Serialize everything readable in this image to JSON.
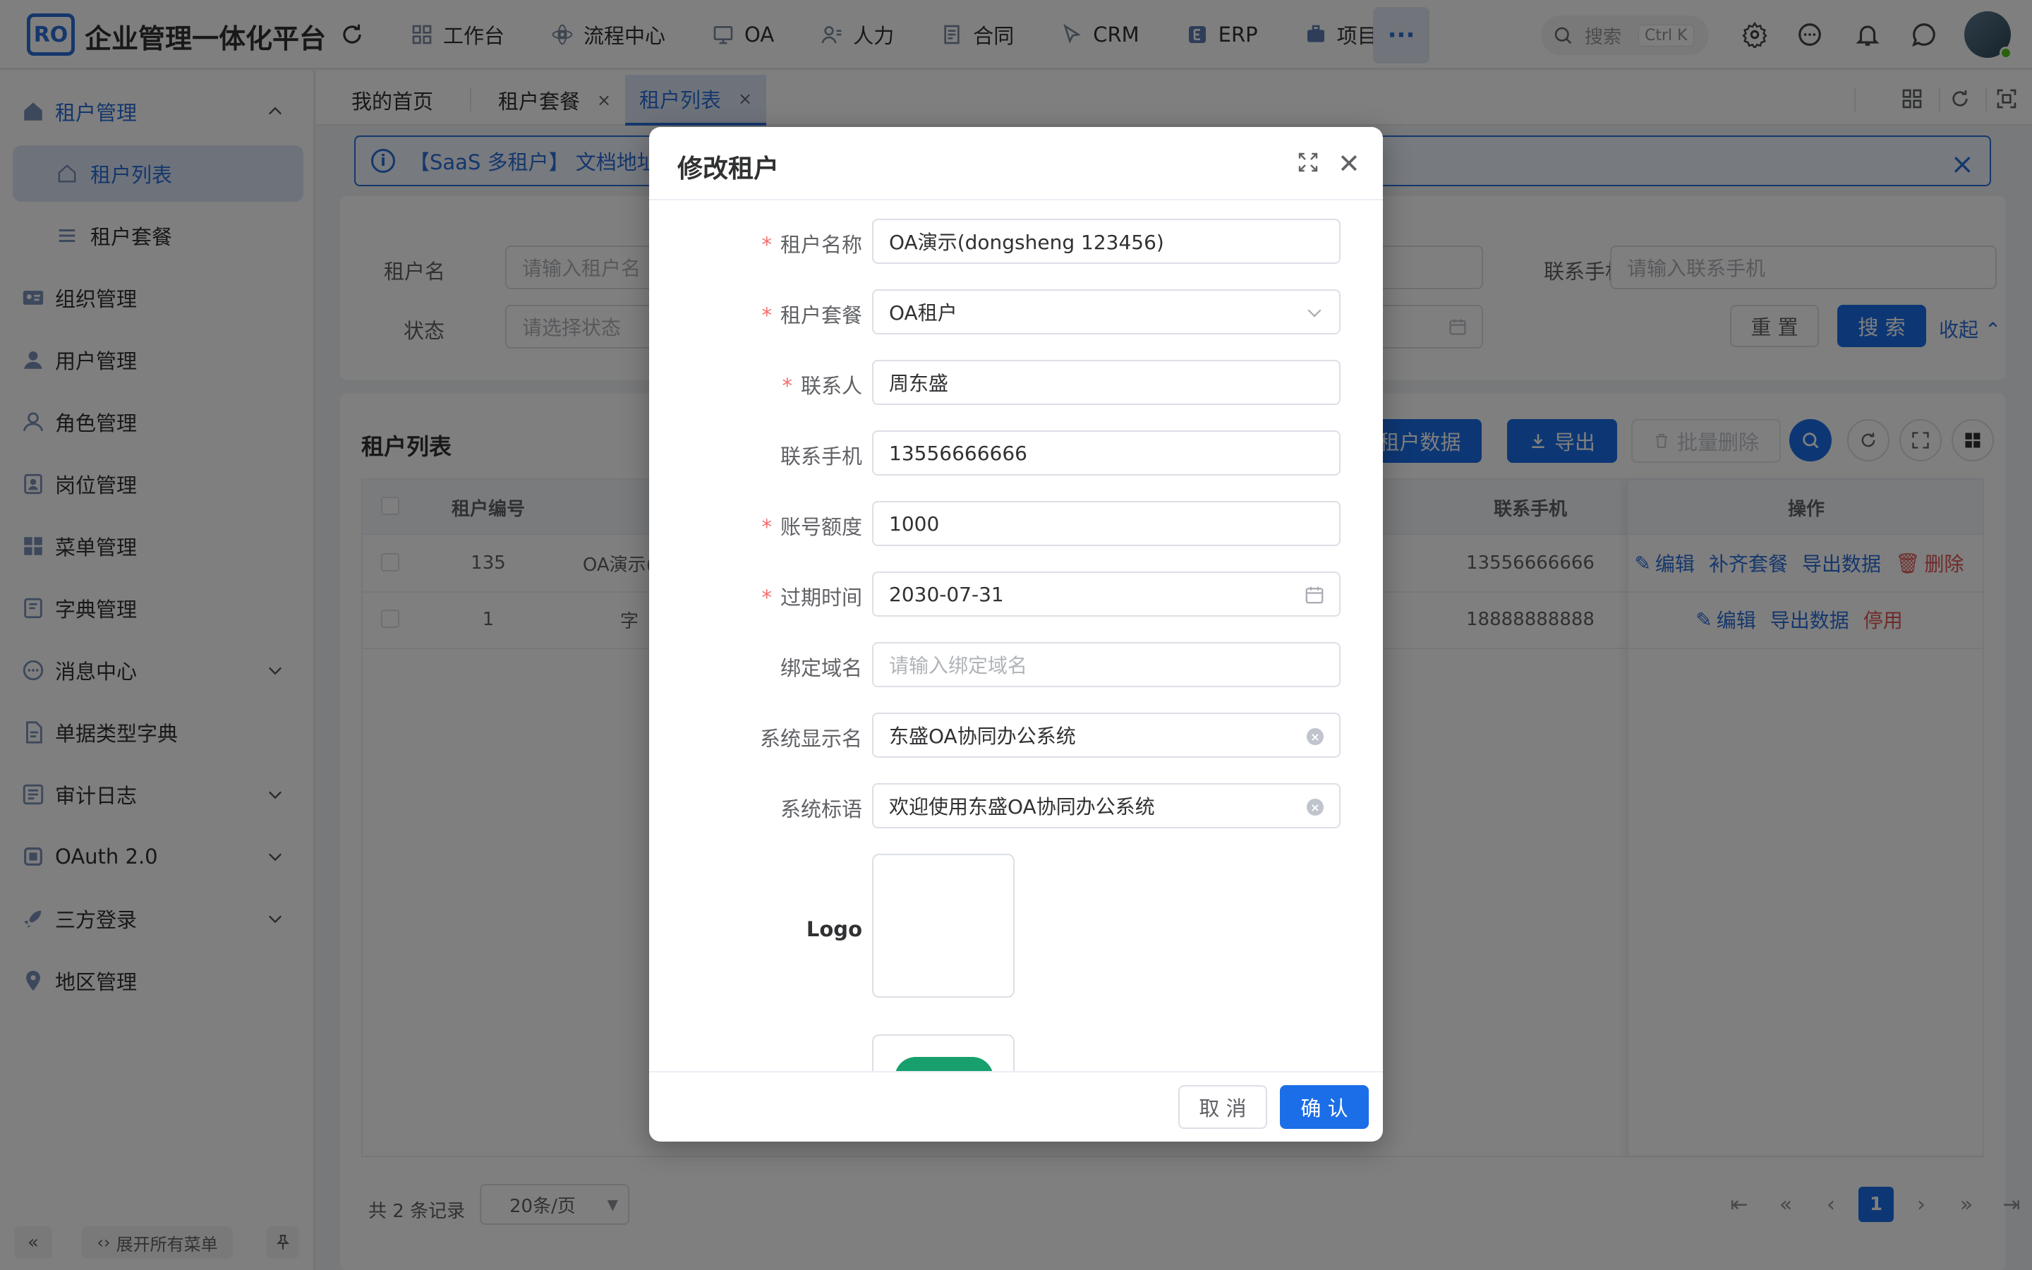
{
  "app": {
    "logo_text": "RO",
    "title": "企业管理一体化平台"
  },
  "topnav": [
    {
      "label": "工作台",
      "icon": "dashboard-icon"
    },
    {
      "label": "流程中心",
      "icon": "workflow-icon"
    },
    {
      "label": "OA",
      "icon": "oa-icon"
    },
    {
      "label": "人力",
      "icon": "hr-icon"
    },
    {
      "label": "合同",
      "icon": "contract-icon"
    },
    {
      "label": "CRM",
      "icon": "crm-icon"
    },
    {
      "label": "ERP",
      "icon": "erp-icon"
    },
    {
      "label": "项目",
      "icon": "project-icon"
    }
  ],
  "more_label": "···",
  "search": {
    "placeholder": "搜索",
    "shortcut": "Ctrl K"
  },
  "sidebar": {
    "group": "租户管理",
    "subitems": [
      {
        "label": "租户列表"
      },
      {
        "label": "租户套餐"
      }
    ],
    "items": [
      {
        "label": "组织管理"
      },
      {
        "label": "用户管理"
      },
      {
        "label": "角色管理"
      },
      {
        "label": "岗位管理"
      },
      {
        "label": "菜单管理"
      },
      {
        "label": "字典管理"
      },
      {
        "label": "消息中心"
      },
      {
        "label": "单据类型字典"
      },
      {
        "label": "审计日志"
      },
      {
        "label": "OAuth 2.0"
      },
      {
        "label": "三方登录"
      },
      {
        "label": "地区管理"
      }
    ],
    "footer": {
      "collapse": "«",
      "expand_all": "展开所有菜单"
    }
  },
  "tabs": [
    {
      "label": "我的首页"
    },
    {
      "label": "租户套餐",
      "close": "×"
    },
    {
      "label": "租户列表",
      "close": "×"
    }
  ],
  "alert": {
    "text": "【SaaS 多租户】 文档地址:",
    "close": "×"
  },
  "filter": {
    "tenant_name_label": "租户名",
    "tenant_name_placeholder": "请输入租户名",
    "phone_label": "联系手机",
    "phone_placeholder": "请输入联系手机",
    "status_label": "状态",
    "status_placeholder": "请选择状态",
    "reset": "重 置",
    "search": "搜 索",
    "collapse": "收起"
  },
  "table": {
    "title": "租户列表",
    "import_label": "入租户数据",
    "export_label": "导出",
    "batch_delete": "批量删除",
    "columns": [
      "租户编号",
      "联系手机",
      "操作"
    ],
    "rows": [
      {
        "id": "135",
        "name": "OA演示(do",
        "phone": "13556666666",
        "ops": [
          {
            "label": "编辑"
          },
          {
            "label": "补齐套餐"
          },
          {
            "label": "导出数据"
          },
          {
            "label": "删除",
            "danger": true
          }
        ]
      },
      {
        "id": "1",
        "name": "字",
        "phone": "18888888888",
        "ops": [
          {
            "label": "编辑"
          },
          {
            "label": "导出数据"
          },
          {
            "label": "停用",
            "danger": true
          }
        ]
      }
    ]
  },
  "pager": {
    "total": "共 2 条记录",
    "size": "20条/页",
    "current": "1"
  },
  "dialog": {
    "title": "修改租户",
    "fields": {
      "tenant_name": {
        "label": "租户名称",
        "value": "OA演示(dongsheng 123456)"
      },
      "package": {
        "label": "租户套餐",
        "value": "OA租户"
      },
      "contact": {
        "label": "联系人",
        "value": "周东盛"
      },
      "phone": {
        "label": "联系手机",
        "value": "13556666666"
      },
      "quota": {
        "label": "账号额度",
        "value": "1000"
      },
      "expire": {
        "label": "过期时间",
        "value": "2030-07-31"
      },
      "domain": {
        "label": "绑定域名",
        "placeholder": "请输入绑定域名"
      },
      "sys_name": {
        "label": "系统显示名",
        "value": "东盛OA协同办公系统"
      },
      "sys_slogan": {
        "label": "系统标语",
        "value": "欢迎使用东盛OA协同办公系统"
      },
      "logo": {
        "label": "Logo"
      }
    },
    "cancel": "取 消",
    "confirm": "确 认"
  },
  "colors": {
    "primary": "#1b6ee8",
    "accent": "#2b6ed8",
    "danger": "#e05555",
    "required": "#f56c6c"
  }
}
